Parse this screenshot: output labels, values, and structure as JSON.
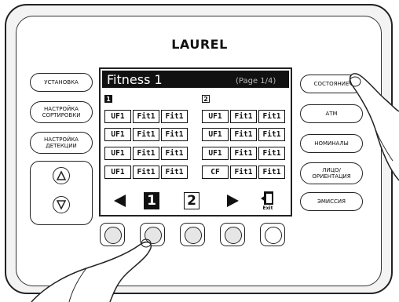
{
  "brand": "LAUREL",
  "left_buttons": [
    {
      "label": "УСТАНОВКА"
    },
    {
      "label": "НАСТРОЙКА\nСОРТИРОВКИ"
    },
    {
      "label": "НАСТРОЙКА\nДЕТЕКЦИИ"
    }
  ],
  "right_buttons": [
    {
      "label": "СОСТОЯНИЕ"
    },
    {
      "label": "АТМ"
    },
    {
      "label": "НОМИНАЛЫ"
    },
    {
      "label": "ЛИЦО/\nОРИЕНТАЦИЯ"
    },
    {
      "label": "ЭМИССИЯ"
    }
  ],
  "screen": {
    "title": "Fitness 1",
    "page": "(Page 1/4)",
    "groups": [
      {
        "label": "1",
        "rows": [
          [
            "UF1",
            "Fit1",
            "Fit1"
          ],
          [
            "UF1",
            "Fit1",
            "Fit1"
          ],
          [
            "UF1",
            "Fit1",
            "Fit1"
          ],
          [
            "UF1",
            "Fit1",
            "Fit1"
          ]
        ]
      },
      {
        "label": "2",
        "rows": [
          [
            "UF1",
            "Fit1",
            "Fit1"
          ],
          [
            "UF1",
            "Fit1",
            "Fit1"
          ],
          [
            "UF1",
            "Fit1",
            "Fit1"
          ],
          [
            "CF",
            "Fit1",
            "Fit1"
          ]
        ]
      }
    ],
    "nav": {
      "page1": "1",
      "page2": "2",
      "exit": "Exit"
    }
  }
}
